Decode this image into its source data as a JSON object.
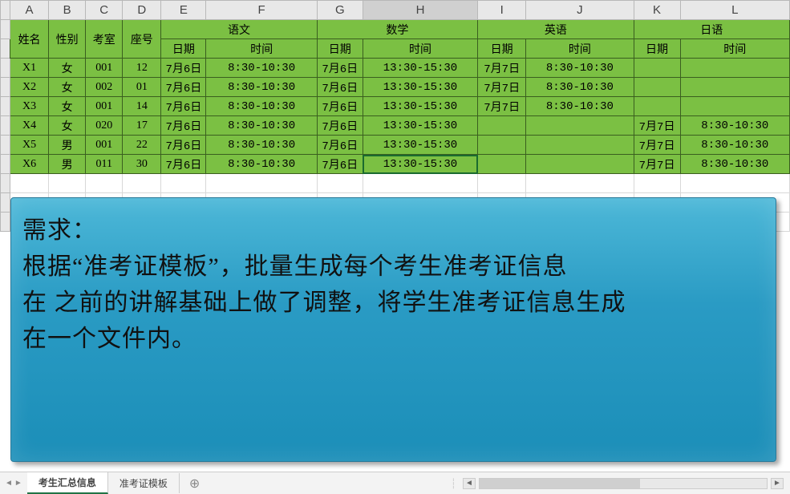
{
  "columns": [
    "A",
    "B",
    "C",
    "D",
    "E",
    "F",
    "G",
    "H",
    "I",
    "J",
    "K",
    "L"
  ],
  "active_column": "H",
  "selected_cell": "H9",
  "headers": {
    "name": "姓名",
    "gender": "性别",
    "room": "考室",
    "seat": "座号",
    "subjects": [
      "语文",
      "数学",
      "英语",
      "日语"
    ],
    "date": "日期",
    "time": "时间"
  },
  "rows": [
    {
      "name": "X1",
      "gender": "女",
      "room": "001",
      "seat": "12",
      "yw_d": "7月6日",
      "yw_t": "8:30-10:30",
      "sx_d": "7月6日",
      "sx_t": "13:30-15:30",
      "yy_d": "7月7日",
      "yy_t": "8:30-10:30",
      "ry_d": "",
      "ry_t": ""
    },
    {
      "name": "X2",
      "gender": "女",
      "room": "002",
      "seat": "01",
      "yw_d": "7月6日",
      "yw_t": "8:30-10:30",
      "sx_d": "7月6日",
      "sx_t": "13:30-15:30",
      "yy_d": "7月7日",
      "yy_t": "8:30-10:30",
      "ry_d": "",
      "ry_t": ""
    },
    {
      "name": "X3",
      "gender": "女",
      "room": "001",
      "seat": "14",
      "yw_d": "7月6日",
      "yw_t": "8:30-10:30",
      "sx_d": "7月6日",
      "sx_t": "13:30-15:30",
      "yy_d": "7月7日",
      "yy_t": "8:30-10:30",
      "ry_d": "",
      "ry_t": ""
    },
    {
      "name": "X4",
      "gender": "女",
      "room": "020",
      "seat": "17",
      "yw_d": "7月6日",
      "yw_t": "8:30-10:30",
      "sx_d": "7月6日",
      "sx_t": "13:30-15:30",
      "yy_d": "",
      "yy_t": "",
      "ry_d": "7月7日",
      "ry_t": "8:30-10:30"
    },
    {
      "name": "X5",
      "gender": "男",
      "room": "001",
      "seat": "22",
      "yw_d": "7月6日",
      "yw_t": "8:30-10:30",
      "sx_d": "7月6日",
      "sx_t": "13:30-15:30",
      "yy_d": "",
      "yy_t": "",
      "ry_d": "7月7日",
      "ry_t": "8:30-10:30"
    },
    {
      "name": "X6",
      "gender": "男",
      "room": "011",
      "seat": "30",
      "yw_d": "7月6日",
      "yw_t": "8:30-10:30",
      "sx_d": "7月6日",
      "sx_t": "13:30-15:30",
      "yy_d": "",
      "yy_t": "",
      "ry_d": "7月7日",
      "ry_t": "8:30-10:30"
    }
  ],
  "note": {
    "title": "需求：",
    "line1": "根据“准考证模板”，批量生成每个考生准考证信息",
    "line2": "在 之前的讲解基础上做了调整，将学生准考证信息生成",
    "line3": "在一个文件内。"
  },
  "tabs": {
    "items": [
      "考生汇总信息",
      "准考证模板"
    ],
    "active_index": 0,
    "add_label": "⊕"
  }
}
